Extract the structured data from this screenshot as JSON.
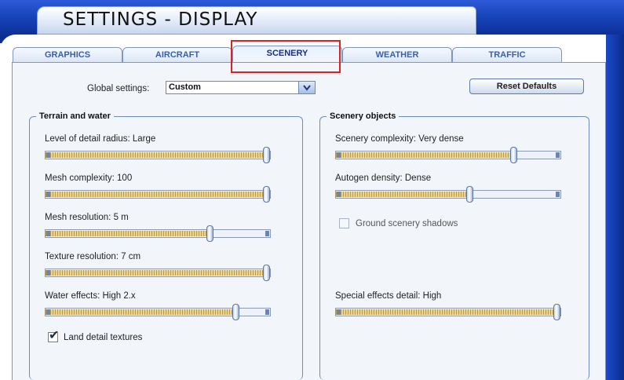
{
  "window": {
    "title": "SETTINGS - DISPLAY"
  },
  "tabs": [
    {
      "label": "GRAPHICS"
    },
    {
      "label": "AIRCRAFT"
    },
    {
      "label": "SCENERY",
      "active": true
    },
    {
      "label": "WEATHER"
    },
    {
      "label": "TRAFFIC"
    }
  ],
  "global_settings": {
    "label": "Global settings:",
    "value": "Custom"
  },
  "reset_button": {
    "label": "Reset Defaults"
  },
  "terrain_group": {
    "title": "Terrain and water",
    "sliders": [
      {
        "label": "Level of detail radius: Large",
        "fraction": 1.0
      },
      {
        "label": "Mesh complexity: 100",
        "fraction": 1.0
      },
      {
        "label": "Mesh resolution: 5 m",
        "fraction": 0.74
      },
      {
        "label": "Texture resolution: 7 cm",
        "fraction": 1.0
      },
      {
        "label": "Water effects: High 2.x",
        "fraction": 0.86
      }
    ],
    "land_detail": {
      "label": "Land detail textures",
      "checked": true
    }
  },
  "scenery_group": {
    "title": "Scenery objects",
    "sliders": [
      {
        "label": "Scenery complexity: Very dense",
        "fraction": 0.8
      },
      {
        "label": "Autogen density: Dense",
        "fraction": 0.6
      },
      {
        "label": "Special effects detail: High",
        "fraction": 1.0
      }
    ],
    "ground_shadows": {
      "label": "Ground scenery shadows",
      "checked": false
    }
  },
  "colors": {
    "accent": "#1a3fb0",
    "highlight": "#e02020",
    "slider_fill": "#d8bf74"
  },
  "icons": {
    "dropdown": "chevron-down-icon",
    "checkbox": "check-icon"
  }
}
